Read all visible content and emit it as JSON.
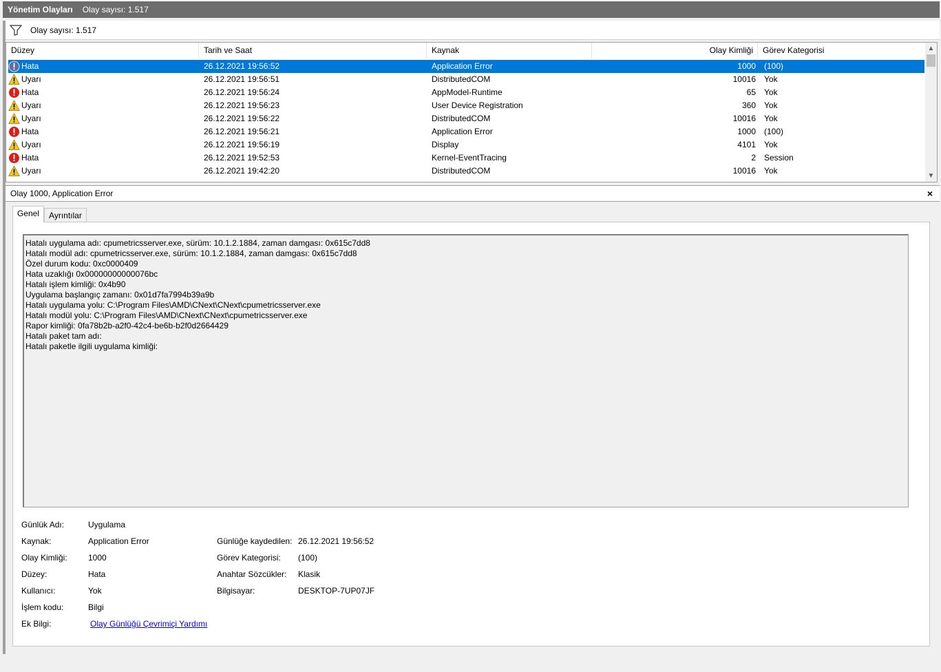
{
  "titlebar": {
    "title": "Yönetim Olayları",
    "count": "Olay sayısı: 1.517"
  },
  "filterbar": {
    "icon": "filter-icon",
    "count": "Olay sayısı: 1.517"
  },
  "grid": {
    "headers": [
      "Düzey",
      "Tarih ve Saat",
      "Kaynak",
      "Olay Kimliği",
      "Görev Kategorisi"
    ],
    "rows": [
      {
        "icon": "error-icon",
        "level": "Hata",
        "datetime": "26.12.2021 19:56:52",
        "source": "Application Error",
        "id": "1000",
        "category": "(100)",
        "selected": true
      },
      {
        "icon": "warning-icon",
        "level": "Uyarı",
        "datetime": "26.12.2021 19:56:51",
        "source": "DistributedCOM",
        "id": "10016",
        "category": "Yok"
      },
      {
        "icon": "error-icon",
        "level": "Hata",
        "datetime": "26.12.2021 19:56:24",
        "source": "AppModel-Runtime",
        "id": "65",
        "category": "Yok"
      },
      {
        "icon": "warning-icon",
        "level": "Uyarı",
        "datetime": "26.12.2021 19:56:23",
        "source": "User Device Registration",
        "id": "360",
        "category": "Yok"
      },
      {
        "icon": "warning-icon",
        "level": "Uyarı",
        "datetime": "26.12.2021 19:56:22",
        "source": "DistributedCOM",
        "id": "10016",
        "category": "Yok"
      },
      {
        "icon": "error-icon",
        "level": "Hata",
        "datetime": "26.12.2021 19:56:21",
        "source": "Application Error",
        "id": "1000",
        "category": "(100)"
      },
      {
        "icon": "warning-icon",
        "level": "Uyarı",
        "datetime": "26.12.2021 19:56:19",
        "source": "Display",
        "id": "4101",
        "category": "Yok"
      },
      {
        "icon": "error-icon",
        "level": "Hata",
        "datetime": "26.12.2021 19:52:53",
        "source": "Kernel-EventTracing",
        "id": "2",
        "category": "Session"
      },
      {
        "icon": "warning-icon",
        "level": "Uyarı",
        "datetime": "26.12.2021 19:42:20",
        "source": "DistributedCOM",
        "id": "10016",
        "category": "Yok"
      }
    ]
  },
  "detail": {
    "title": "Olay 1000, Application Error",
    "close": "×",
    "tabs": [
      "Genel",
      "Ayrıntılar"
    ],
    "description": [
      "Hatalı uygulama adı: cpumetricsserver.exe, sürüm: 10.1.2.1884, zaman damgası: 0x615c7dd8",
      "Hatalı modül adı: cpumetricsserver.exe, sürüm: 10.1.2.1884, zaman damgası: 0x615c7dd8",
      "Özel durum kodu: 0xc0000409",
      "Hata uzaklığı 0x00000000000076bc",
      "Hatalı işlem kimliği: 0x4b90",
      "Uygulama başlangıç zamanı: 0x01d7fa7994b39a9b",
      "Hatalı uygulama yolu: C:\\Program Files\\AMD\\CNext\\CNext\\cpumetricsserver.exe",
      "Hatalı modül yolu: C:\\Program Files\\AMD\\CNext\\CNext\\cpumetricsserver.exe",
      "Rapor kimliği: 0fa78b2b-a2f0-42c4-be6b-b2f0d2664429",
      "Hatalı paket tam adı:",
      "Hatalı paketle ilgili uygulama kimliği:"
    ],
    "props": {
      "log_name_label": "Günlük Adı:",
      "log_name": "Uygulama",
      "source_label": "Kaynak:",
      "source": "Application Error",
      "logged_label": "Günlüğe kaydedilen:",
      "logged": "26.12.2021 19:56:52",
      "event_id_label": "Olay Kimliği:",
      "event_id": "1000",
      "task_label": "Görev Kategorisi:",
      "task": "(100)",
      "level_label": "Düzey:",
      "level": "Hata",
      "keywords_label": "Anahtar Sözcükler:",
      "keywords": "Klasik",
      "user_label": "Kullanıcı:",
      "user": "Yok",
      "computer_label": "Bilgisayar:",
      "computer": "DESKTOP-7UP07JF",
      "opcode_label": "İşlem kodu:",
      "opcode": "Bilgi",
      "more_info_label": "Ek Bilgi:",
      "more_info_link": "Olay Günlüğü Çevrimiçi Yardımı"
    }
  }
}
